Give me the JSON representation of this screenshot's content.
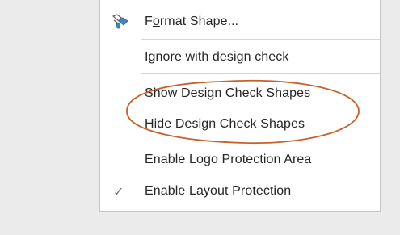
{
  "menu": {
    "items": [
      {
        "label_prefix": "F",
        "label_underlined": "o",
        "label_suffix": "rmat Shape...",
        "icon": "format-shape-icon"
      },
      {
        "label": "Ignore with design check"
      },
      {
        "label": "Show Design Check Shapes"
      },
      {
        "label": "Hide Design Check Shapes"
      },
      {
        "label": "Enable Logo Protection Area"
      },
      {
        "label": "Enable Layout Protection",
        "checked": true,
        "check_glyph": "✓"
      }
    ]
  },
  "annotation": {
    "shape": "ellipse",
    "color": "#c5622b"
  }
}
